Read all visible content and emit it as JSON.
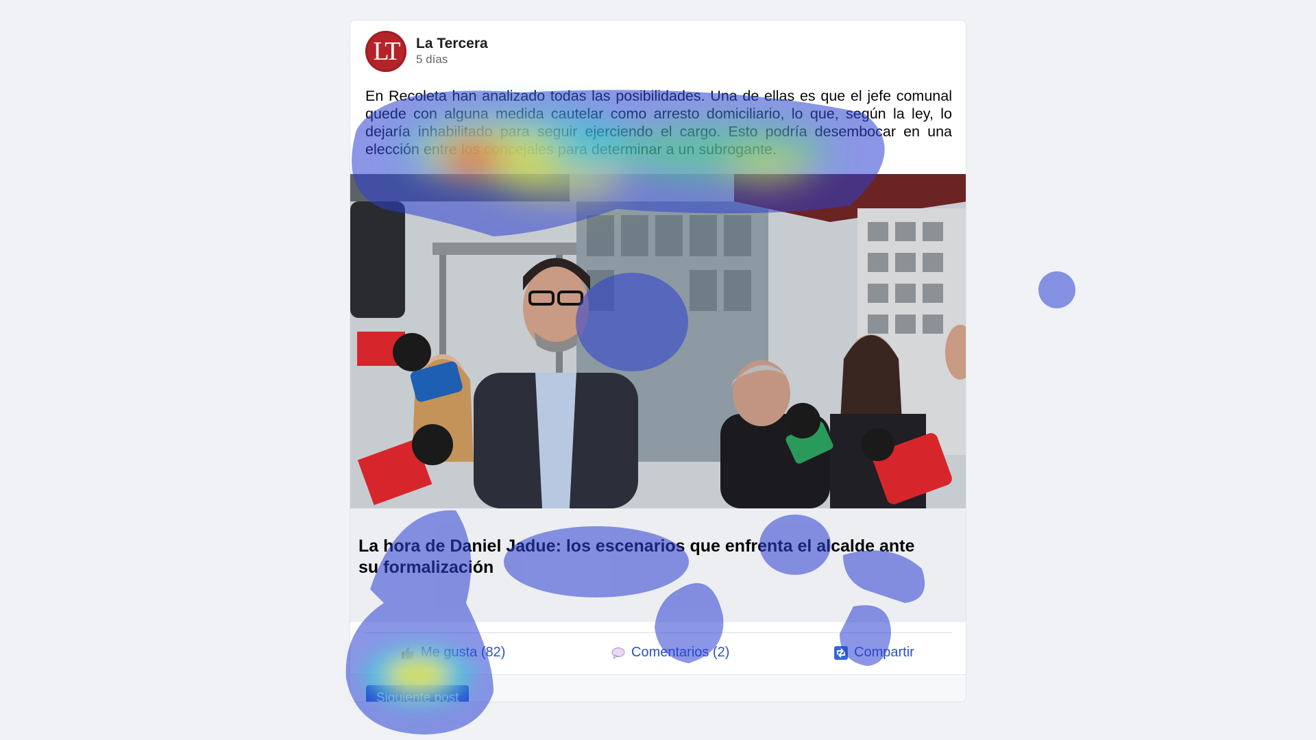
{
  "post": {
    "page_name": "La Tercera",
    "avatar_text": "LT",
    "time_ago": "5 días",
    "text": "En Recoleta han analizado todas las posibilidades. Una de ellas es que el jefe comunal quede con alguna medida cautelar como arresto domiciliario, lo que, según la ley, lo dejaría inhabilitado para seguir ejerciendo el cargo. Esto podría desembocar en una elección entre los concejales para determinar a un subrogante.",
    "image_icon": "news-photo-press-scrum",
    "link_title": "La hora de Daniel Jadue: los escenarios que enfrenta el alcalde ante su formalización"
  },
  "actions": {
    "like_label": "Me gusta (82)",
    "like_icon": "thumbs-up-icon",
    "comment_label": "Comentarios (2)",
    "comment_icon": "speech-bubble-icon",
    "share_label": "Compartir",
    "share_icon": "share-icon"
  },
  "footer": {
    "next_label": "Siguiente post"
  },
  "colors": {
    "page_background": "#f0f2f5",
    "avatar": "#b5232a",
    "action_link": "#2851c7",
    "next_button": "#2f4fd0"
  }
}
